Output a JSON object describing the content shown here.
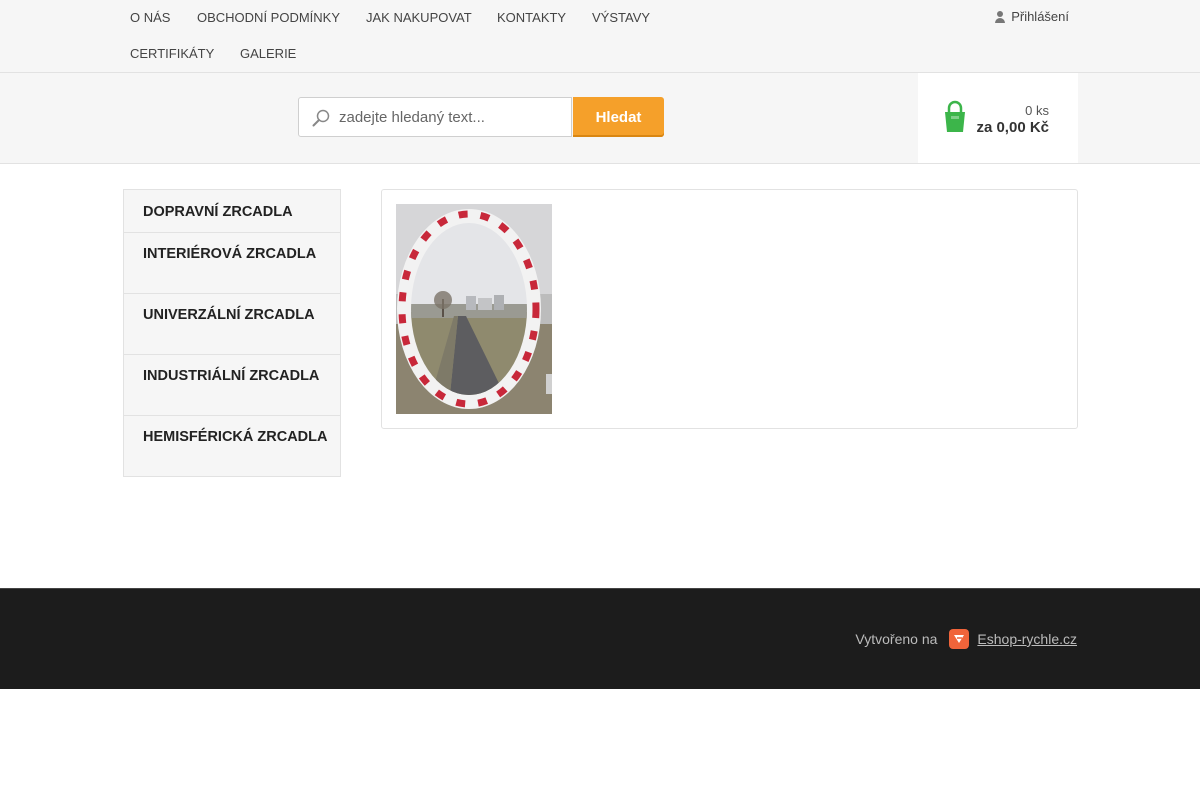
{
  "topnav": {
    "items": [
      "O NÁS",
      "OBCHODNÍ PODMÍNKY",
      "JAK NAKUPOVAT",
      "KONTAKTY",
      "VÝSTAVY",
      "CERTIFIKÁTY",
      "GALERIE"
    ],
    "login_label": "Přihlášení"
  },
  "search": {
    "placeholder": "zadejte hledaný text...",
    "button_label": "Hledat"
  },
  "cart": {
    "count": "0 ks",
    "total": "za 0,00 Kč"
  },
  "sidebar": {
    "categories": [
      "DOPRAVNÍ ZRCADLA",
      "INTERIÉROVÁ ZRCADLA",
      "UNIVERZÁLNÍ ZRCADLA",
      "INDUSTRIÁLNÍ ZRCADLA",
      "HEMISFÉRICKÁ ZRCADLA"
    ]
  },
  "footer": {
    "credit_text": "Vytvořeno na",
    "credit_link": "Eshop-rychle.cz"
  },
  "colors": {
    "accent": "#f5a02a",
    "cart_icon": "#3cb54a",
    "footer_bg": "#1c1c1c"
  },
  "icons": {
    "search": "search-icon",
    "cart": "cart-icon",
    "user": "user-icon",
    "credit_logo": "eshop-logo-icon"
  }
}
